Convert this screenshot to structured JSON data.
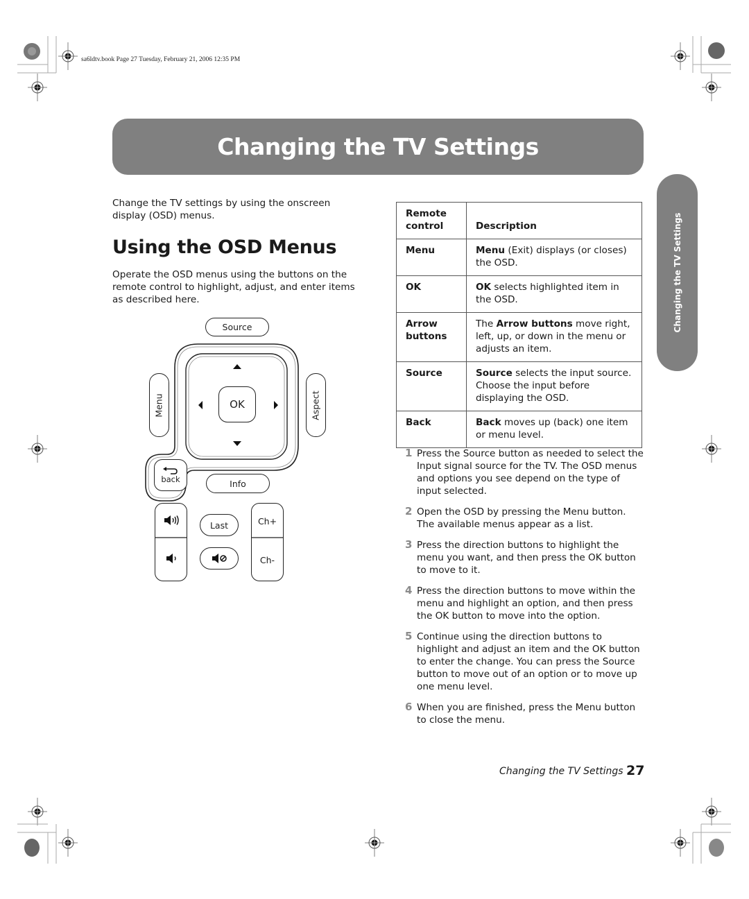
{
  "print_slug": "sa6ldtv.book  Page 27  Tuesday, February 21, 2006  12:35 PM",
  "banner_title": "Changing the TV Settings",
  "side_tab": "Changing the TV Settings",
  "intro": "Change the TV settings by using the onscreen display (OSD) menus.",
  "section_heading": "Using the OSD Menus",
  "section_body": "Operate the OSD menus using the buttons on the remote control to highlight, adjust, and enter items as described here.",
  "remote": {
    "source": "Source",
    "menu": "Menu",
    "aspect": "Aspect",
    "ok": "OK",
    "back": "back",
    "info": "Info",
    "last": "Last",
    "ch_up": "Ch+",
    "ch_down": "Ch-",
    "icons": [
      "arrow-up-icon",
      "arrow-down-icon",
      "arrow-left-icon",
      "arrow-right-icon",
      "back-arrow-icon",
      "volume-up-icon",
      "volume-down-icon",
      "mute-icon"
    ]
  },
  "table": {
    "headers": [
      "Remote control",
      "Description"
    ],
    "rows": [
      {
        "control": "Menu",
        "bold": "Menu",
        "rest": " (Exit) displays (or closes) the OSD."
      },
      {
        "control": "OK",
        "bold": "OK",
        "rest": " selects highlighted item in the OSD."
      },
      {
        "control": "Arrow buttons",
        "pre": "The ",
        "bold": "Arrow buttons",
        "rest": " move right, left, up, or down in the menu or adjusts an item."
      },
      {
        "control": "Source",
        "bold": "Source",
        "rest": " selects the input source. Choose the input before displaying the OSD."
      },
      {
        "control": "Back",
        "bold": "Back",
        "rest": " moves up (back) one item or menu level."
      }
    ]
  },
  "steps": [
    {
      "num": "1",
      "text": "Press the Source button as needed to select the Input signal source for the TV. The OSD menus and options you see depend on the type of input selected."
    },
    {
      "num": "2",
      "text": "Open the OSD by pressing the Menu button. The available menus appear as a list."
    },
    {
      "num": "3",
      "text": "Press the direction buttons to highlight the menu you want, and then press the OK button to move to it."
    },
    {
      "num": "4",
      "text": "Press the direction buttons to move within the menu and highlight an option, and then press the OK button to move into the option."
    },
    {
      "num": "5",
      "text": "Continue using the direction buttons to highlight and adjust an item and the OK button to enter the change. You can press the Source button to move out of an option or to move up one menu level."
    },
    {
      "num": "6",
      "text": "When you are finished, press the Menu button to close the menu."
    }
  ],
  "footer": {
    "section": "Changing the TV Settings",
    "page": "27"
  },
  "colors": {
    "banner": "#808080",
    "step_number": "#8a8a8a"
  }
}
